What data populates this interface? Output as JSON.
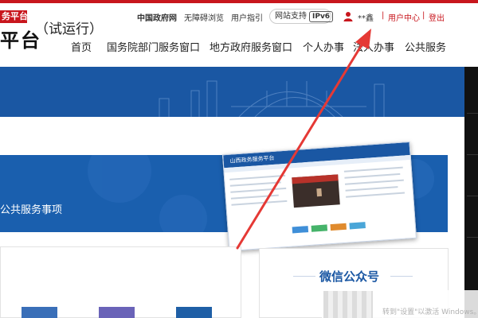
{
  "logo": {
    "badge": "务平台",
    "main": "平台",
    "sub": "（试运行）"
  },
  "top_bar": {
    "gov_link": "中国政府网",
    "accessible": "无障碍浏览",
    "guide": "用户指引",
    "support_label": "网站支持",
    "ipv6": "IPv6",
    "username": "**鑫",
    "separator": "|",
    "user_center": "用户中心",
    "logout": "登出"
  },
  "nav": {
    "items": [
      "首页",
      "国务院部门服务窗口",
      "地方政府服务窗口",
      "个人办事",
      "法人办事",
      "公共服务"
    ]
  },
  "main": {
    "service_text": "公共服务事项",
    "mock_title": "山西政务服务平台"
  },
  "side": {
    "wechat_title": "微信公众号"
  },
  "overlay": {
    "watermark": "转到\"设置\"以激活 Windows。"
  },
  "colors": {
    "brand_red": "#c8161d",
    "brand_blue": "#1a57a3",
    "arrow": "#e53935"
  },
  "icons": [
    "user-icon",
    "ipv6-badge-icon",
    "red-arrow-annotation"
  ]
}
